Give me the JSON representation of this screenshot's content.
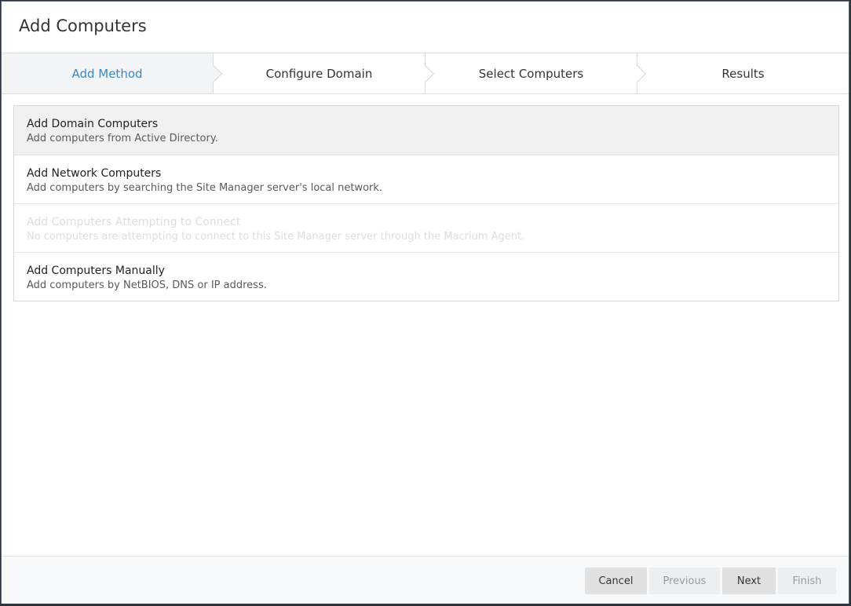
{
  "dialog": {
    "title": "Add Computers"
  },
  "steps": [
    {
      "label": "Add Method",
      "active": true
    },
    {
      "label": "Configure Domain",
      "active": false
    },
    {
      "label": "Select Computers",
      "active": false
    },
    {
      "label": "Results",
      "active": false
    }
  ],
  "options": [
    {
      "title": "Add Domain Computers",
      "description": "Add computers from Active Directory.",
      "state": "selected"
    },
    {
      "title": "Add Network Computers",
      "description": "Add computers by searching the Site Manager server's local network.",
      "state": "normal"
    },
    {
      "title": "Add Computers Attempting to Connect",
      "description": "No computers are attempting to connect to this Site Manager server through the Macrium Agent.",
      "state": "disabled"
    },
    {
      "title": "Add Computers Manually",
      "description": "Add computers by NetBIOS, DNS or IP address.",
      "state": "normal"
    }
  ],
  "footer": {
    "cancel_label": "Cancel",
    "previous_label": "Previous",
    "next_label": "Next",
    "finish_label": "Finish"
  },
  "colors": {
    "accent": "#3a86c8",
    "selected_bg": "#f0f0f0",
    "footer_bg": "#f7f8f9"
  }
}
